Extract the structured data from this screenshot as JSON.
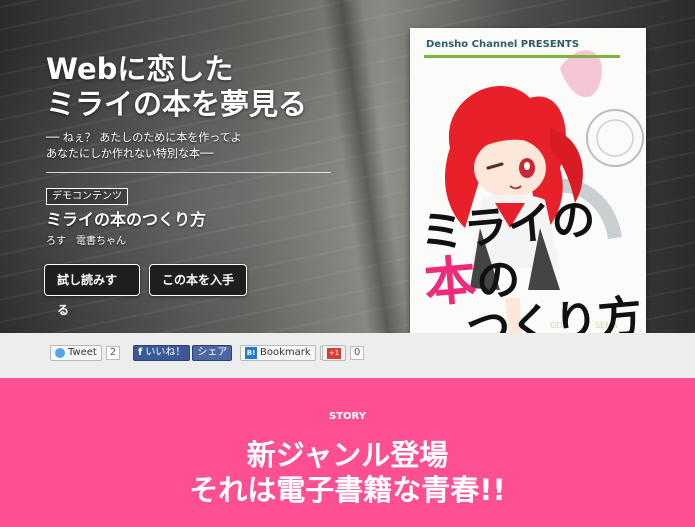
{
  "hero": {
    "title_line1": "Webに恋した",
    "title_line2": "ミライの本を夢見る",
    "tagline_line1": "── ねぇ？ あたしのために本を作ってよ",
    "tagline_line2": "あなたにしか作れない特別な本──",
    "badge": "デモコンテンツ",
    "book_title": "ミライの本のつくり方",
    "author": "ろす　電書ちゃん",
    "read_button": "試し読みする",
    "buy_button": "この本を入手"
  },
  "cover": {
    "presents": "Densho Channel PRESENTS",
    "title_part1": "ミライの",
    "title_highlight": "本",
    "title_part2": "の",
    "title_line2": "つくり方",
    "colors": {
      "hair": "#e8202a",
      "title_highlight": "#ee2a7b",
      "bar": "#7ab43a"
    }
  },
  "share": {
    "tweet_label": "Tweet",
    "tweet_count": "2",
    "like_label": "いいね！",
    "fb_share_label": "シェア",
    "hatena_icon": "B!",
    "bookmark_label": "Bookmark",
    "bookmark_count": "0",
    "gplus_label": "+1",
    "gplus_count": "0"
  },
  "story": {
    "label": "STORY",
    "heading_line1": "新ジャンル登場",
    "heading_line2": "それは電子書籍な青春!!"
  },
  "colors": {
    "accent": "#ff4f93",
    "button": "#1f1f1f"
  }
}
